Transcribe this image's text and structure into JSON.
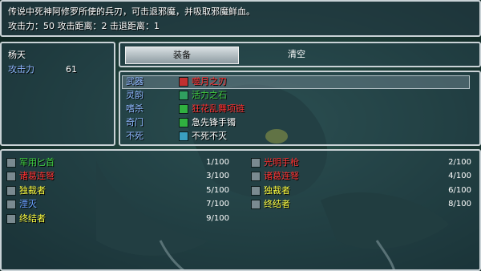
{
  "help": {
    "line1": "传说中死神阿修罗所使的兵刃，可击退邪魔，并吸取邪魔鲜血。",
    "line2": "攻击力：50  攻击距离：2 击退距离：1"
  },
  "status": {
    "actor_name": "杨天",
    "stat_label": "攻击力",
    "stat_value": "61"
  },
  "commands": [
    {
      "label": "装备",
      "selected": true
    },
    {
      "label": "清空",
      "selected": false
    }
  ],
  "slots": [
    {
      "type": "武器",
      "item": "噬月之刃",
      "color": "#ff3030",
      "icon": "blade-icon",
      "icon_color": "#c03030"
    },
    {
      "type": "灵韵",
      "item": "活力之石",
      "color": "#40d040",
      "icon": "orb-icon",
      "icon_color": "#30a060"
    },
    {
      "type": "嗜杀",
      "item": "狂花乱舞项链",
      "color": "#ff3030",
      "icon": "necklace-icon",
      "icon_color": "#30b040"
    },
    {
      "type": "奇门",
      "item": "急先锋手镯",
      "color": "#ffffff",
      "icon": "bracelet-icon",
      "icon_color": "#30b040"
    },
    {
      "type": "不死",
      "item": "不死不灭",
      "color": "#ffffff",
      "icon": "feather-icon",
      "icon_color": "#3aa0c0"
    }
  ],
  "inventory": [
    {
      "name": "军用匕首",
      "count": "1/100",
      "color": "#40d040",
      "icon": "dagger-icon"
    },
    {
      "name": "光明手枪",
      "count": "2/100",
      "color": "#ff3030",
      "icon": "pistol-icon"
    },
    {
      "name": "诸葛连弩",
      "count": "3/100",
      "color": "#ff3030",
      "icon": "crossbow-icon"
    },
    {
      "name": "诸葛连弩",
      "count": "4/100",
      "color": "#ff3030",
      "icon": "crossbow-icon"
    },
    {
      "name": "独裁者",
      "count": "5/100",
      "color": "#ffff40",
      "icon": "gun-icon"
    },
    {
      "name": "独裁者",
      "count": "6/100",
      "color": "#ffff40",
      "icon": "gun-icon"
    },
    {
      "name": "湮灭",
      "count": "7/100",
      "color": "#6aa0ff",
      "icon": "gun-icon"
    },
    {
      "name": "终结者",
      "count": "8/100",
      "color": "#ffff40",
      "icon": "gun-icon"
    },
    {
      "name": "终结者",
      "count": "9/100",
      "color": "#ffff40",
      "icon": "gun-icon"
    }
  ]
}
